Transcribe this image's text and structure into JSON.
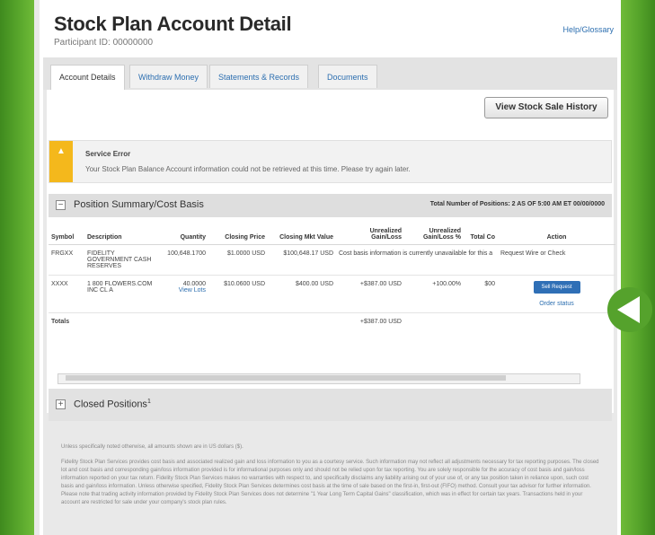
{
  "header": {
    "title": "Stock Plan Account Detail",
    "participant_id": "Participant ID: 00000000",
    "help_link": "Help/Glossary"
  },
  "tabs": [
    {
      "label": "Account Details",
      "active": true
    },
    {
      "label": "Withdraw Money",
      "active": false
    },
    {
      "label": "Statements & Records",
      "active": false
    },
    {
      "label": "Documents",
      "active": false
    }
  ],
  "toolbar": {
    "history_button": "View Stock Sale History"
  },
  "alert": {
    "title": "Service Error",
    "message": "Your Stock Plan Balance Account information could not be retrieved at this time. Please try again later.",
    "icon": "warning-icon",
    "color": "#f4b81c"
  },
  "position_summary": {
    "title": "Position Summary/Cost Basis",
    "meta": "Total Number of Positions: 2    AS OF 5:00 AM ET 00/00/0000",
    "columns": [
      "Symbol",
      "Description",
      "Quantity",
      "Closing Price",
      "Closing Mkt Value",
      "Unrealized Gain/Loss",
      "Unrealized Gain/Loss %",
      "Total Co",
      "Action"
    ],
    "rows": [
      {
        "symbol": "FRGXX",
        "description": "FIDELITY GOVERNMENT CASH RESERVES",
        "quantity": "100,648.1700",
        "closing_price": "$1.0000 USD",
        "closing_mkt_value": "$100,648.17 USD",
        "note": "Cost basis information is currently unavailable for this a",
        "action": "Request Wire or Check"
      },
      {
        "symbol": "XXXX",
        "description": "1 800 FLOWERS.COM INC CL A",
        "quantity": "40.0000",
        "quantity_link": "View Lots",
        "closing_price": "$10.0600 USD",
        "closing_mkt_value": "$400.00 USD",
        "gain_loss": "+$387.00 USD",
        "gain_loss_pct": "+100.00%",
        "total_cost": "$00",
        "action_button": "Sell Request",
        "action_link": "Order status"
      }
    ],
    "totals_label": "Totals",
    "totals_value": "+$387.00 USD",
    "accent_color": "#2f6fb6",
    "gain_color": "#2f8a2f"
  },
  "closed_positions": {
    "title": "Closed Positions",
    "superscript": "1"
  },
  "footer": {
    "line1": "Unless specifically noted otherwise, all amounts shown are in US dollars ($).",
    "line2": "Fidelity Stock Plan Services provides cost basis and associated realized gain and loss information to you as a courtesy service. Such information may not reflect all adjustments necessary for tax reporting purposes. The closed lot and cost basis and corresponding gain/loss information provided is for informational purposes only and should not be relied upon for tax reporting. You are solely responsible for the accuracy of cost basis and gain/loss information reported on your tax return. Fidelity Stock Plan Services makes no warranties with respect to, and specifically disclaims any liability arising out of your use of, or any tax position taken in reliance upon, such cost basis and gain/loss information. Unless otherwise specified, Fidelity Stock Plan Services determines cost basis at the time of sale based on the first-in, first-out (FIFO) method. Consult your tax advisor for further information. Please note that trading activity information provided by Fidelity Stock Plan Services does not determine \"1 Year Long Term Capital Gains\" classification, which was in effect for certain tax years. Transactions held in your account are restricted for sale under your company's stock plan rules."
  },
  "overlay": {
    "play_icon": "play-back-icon",
    "color": "#55a22c"
  }
}
